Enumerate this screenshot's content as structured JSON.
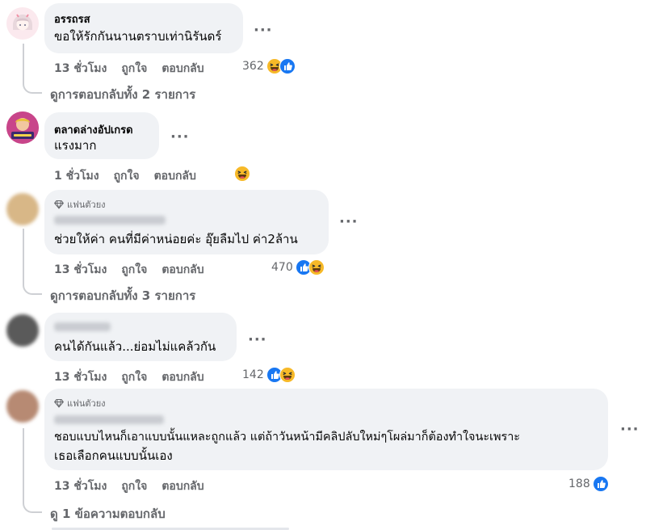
{
  "comments": [
    {
      "author": "อรรถรส",
      "text": "ขอให้รักกันนานตราบเท่านิรันดร์",
      "time": "13 ชั่วโมง",
      "like": "ถูกใจ",
      "reply": "ตอบกลับ",
      "reaction_count": "362",
      "reactions": [
        "haha-icon",
        "like-icon"
      ],
      "view_replies": "ดูการตอบกลับทั้ง 2 รายการ"
    },
    {
      "author": "ตลาดล่างอัปเกรด",
      "text": "แรงมาก",
      "time": "1 ชั่วโมง",
      "like": "ถูกใจ",
      "reply": "ตอบกลับ",
      "reaction_count": "",
      "reactions": [
        "haha-icon"
      ]
    },
    {
      "badge": "แฟนตัวยง",
      "text": "ช่วยให้ค่า คนที่มีค่าหน่อยค่ะ อุ๊ยลืมไป ค่า2ล้าน",
      "time": "13 ชั่วโมง",
      "like": "ถูกใจ",
      "reply": "ตอบกลับ",
      "reaction_count": "470",
      "reactions": [
        "like-icon",
        "haha-icon"
      ],
      "view_replies": "ดูการตอบกลับทั้ง 3 รายการ"
    },
    {
      "text": "คนได้กันแล้ว...ย่อมไม่แคล้วกัน",
      "time": "13 ชั่วโมง",
      "like": "ถูกใจ",
      "reply": "ตอบกลับ",
      "reaction_count": "142",
      "reactions": [
        "like-icon",
        "haha-icon"
      ]
    },
    {
      "badge": "แฟนตัวยง",
      "text_line1": "ชอบแบบไหนก็เอาแบบนั้นแหละถูกแล้ว แต่ถ้าวันหน้ามีคลิปลับใหม่ๆโผล่มาก็ต้องทำใจนะเพราะ",
      "text_line2": "เธอเลือกคนแบบนั้นเอง",
      "time": "13 ชั่วโมง",
      "like": "ถูกใจ",
      "reply": "ตอบกลับ",
      "reaction_count": "188",
      "reactions": [
        "like-icon"
      ],
      "view_replies": "ดู 1 ข้อความตอบกลับ"
    }
  ],
  "more_glyph": "···",
  "colors": {
    "bubble": "#f0f2f5",
    "meta": "#65676b",
    "like_blue": "#1877f2",
    "haha_yellow": "#f7b928"
  }
}
